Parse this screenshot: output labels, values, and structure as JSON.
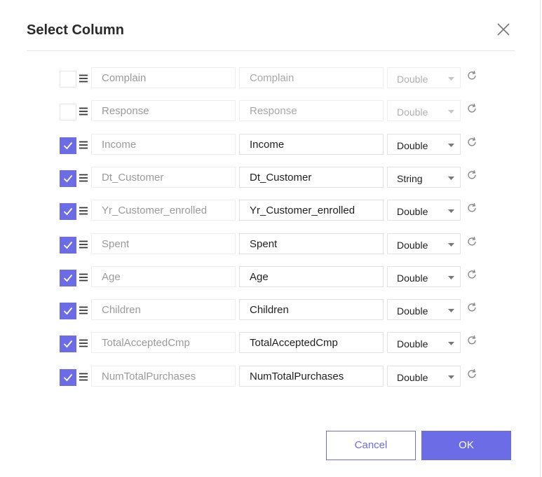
{
  "dialog": {
    "title": "Select Column",
    "close_icon": "close-icon",
    "cancel_label": "Cancel",
    "ok_label": "OK",
    "accent_color": "#6b6ce6"
  },
  "rows": [
    {
      "checked": false,
      "source": "Complain",
      "target": "Complain",
      "type": "Double"
    },
    {
      "checked": false,
      "source": "Response",
      "target": "Response",
      "type": "Double"
    },
    {
      "checked": true,
      "source": "Income",
      "target": "Income",
      "type": "Double"
    },
    {
      "checked": true,
      "source": "Dt_Customer",
      "target": "Dt_Customer",
      "type": "String"
    },
    {
      "checked": true,
      "source": "Yr_Customer_enrolled",
      "target": "Yr_Customer_enrolled",
      "type": "Double"
    },
    {
      "checked": true,
      "source": "Spent",
      "target": "Spent",
      "type": "Double"
    },
    {
      "checked": true,
      "source": "Age",
      "target": "Age",
      "type": "Double"
    },
    {
      "checked": true,
      "source": "Children",
      "target": "Children",
      "type": "Double"
    },
    {
      "checked": true,
      "source": "TotalAcceptedCmp",
      "target": "TotalAcceptedCmp",
      "type": "Double"
    },
    {
      "checked": true,
      "source": "NumTotalPurchases",
      "target": "NumTotalPurchases",
      "type": "Double"
    }
  ]
}
